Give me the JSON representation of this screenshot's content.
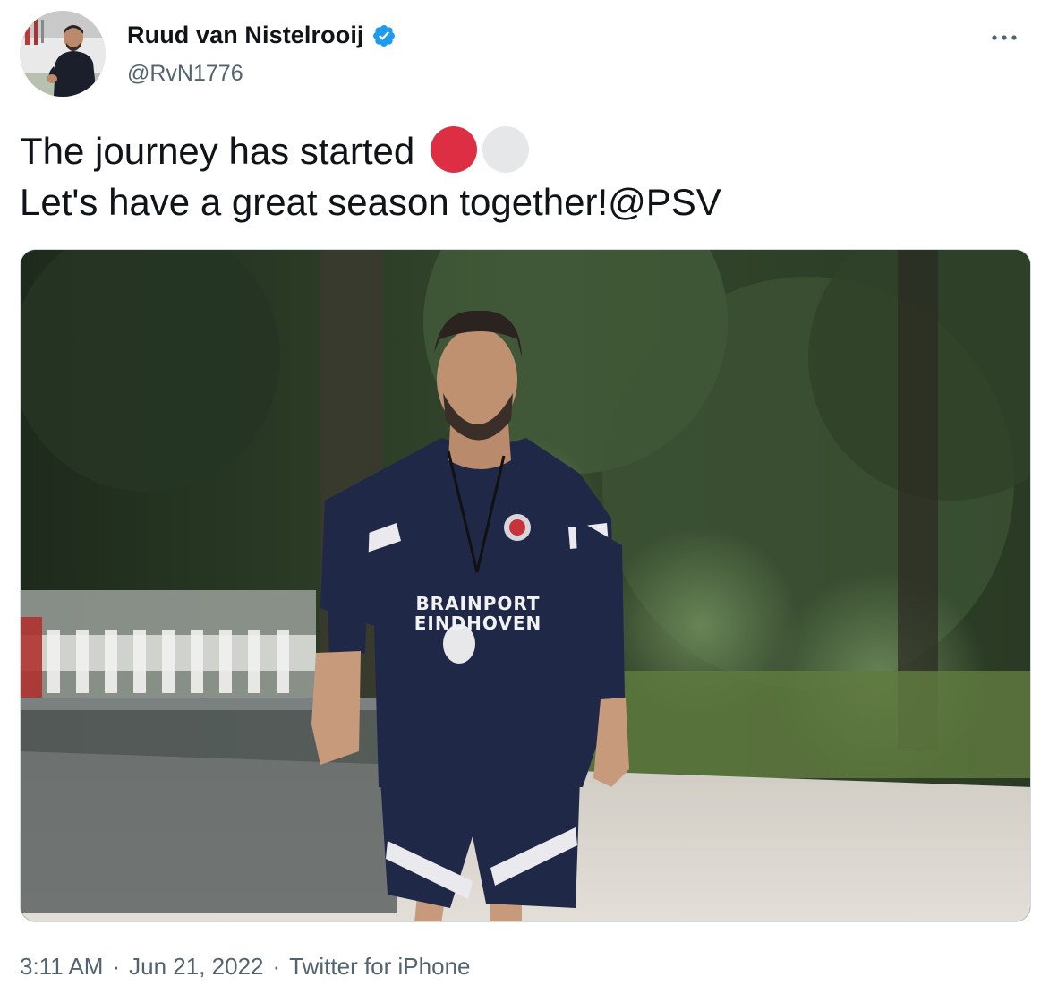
{
  "user": {
    "display_name": "Ruud van Nistelrooij",
    "handle": "@RvN1776",
    "verified": true,
    "avatar_icon": "profile-photo"
  },
  "tweet": {
    "line1_text": "The journey has started",
    "line1_emojis": [
      "red-circle",
      "white-circle"
    ],
    "line2_text": "Let's have a great season together!",
    "line2_mention": "@PSV"
  },
  "media": {
    "jersey_line1": "BRAINPORT",
    "jersey_line2": "EINDHOVEN"
  },
  "meta": {
    "time": "3:11 AM",
    "separator1": "·",
    "date": "Jun 21, 2022",
    "separator2": "·",
    "source": "Twitter for iPhone"
  },
  "colors": {
    "verified_blue": "#1d9bf0",
    "secondary_text": "#536471",
    "red_circle": "#dd2e44",
    "white_circle": "#e6e7e8"
  }
}
